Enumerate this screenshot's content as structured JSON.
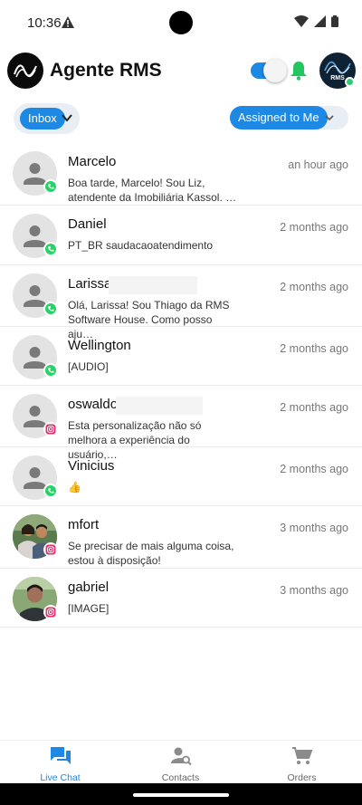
{
  "status_bar": {
    "time": "10:36"
  },
  "header": {
    "title": "Agente RMS",
    "agent_avatar_text": "RMS",
    "availability_on": true
  },
  "filters": {
    "inbox_label": "Inbox",
    "assigned_label": "Assigned to Me"
  },
  "conversations": [
    {
      "name": "Marcelo",
      "time": "an hour ago",
      "preview": "Boa tarde, Marcelo! Sou Liz, atendente da Imobiliária Kassol. …",
      "channel": "whatsapp-icon",
      "avatar": "default"
    },
    {
      "name": "Daniel",
      "time": "2 months ago",
      "preview": "PT_BR saudacaoatendimento",
      "channel": "whatsapp-icon",
      "avatar": "default"
    },
    {
      "name": "Larissa",
      "time": "2 months ago",
      "preview": "Olá, Larissa! Sou Thiago da RMS Software House. Como posso aju…",
      "channel": "whatsapp-icon",
      "avatar": "default"
    },
    {
      "name": "Wellington",
      "time": "2 months ago",
      "preview": "[AUDIO]",
      "channel": "whatsapp-icon",
      "avatar": "default"
    },
    {
      "name": "oswaldo",
      "time": "2 months ago",
      "preview": "Esta personalização não só melhora a experiência do usuário,…",
      "channel": "instagram-icon",
      "avatar": "default"
    },
    {
      "name": "Vinicius",
      "time": "2 months ago",
      "preview": "👍",
      "channel": "whatsapp-icon",
      "avatar": "default"
    },
    {
      "name": "mfort",
      "time": "3 months ago",
      "preview": "Se precisar de mais alguma coisa, estou à disposição!",
      "channel": "instagram-icon",
      "avatar": "photo-couple"
    },
    {
      "name": "gabriel",
      "time": "3 months ago",
      "preview": "[IMAGE]",
      "channel": "instagram-icon",
      "avatar": "photo-man"
    }
  ],
  "bottom_nav": {
    "live_chat": "Live Chat",
    "contacts": "Contacts",
    "orders": "Orders"
  },
  "colors": {
    "accent": "#1e88e5",
    "online": "#2ecc71",
    "whatsapp": "#25d366",
    "instagram": "#e1306c"
  }
}
